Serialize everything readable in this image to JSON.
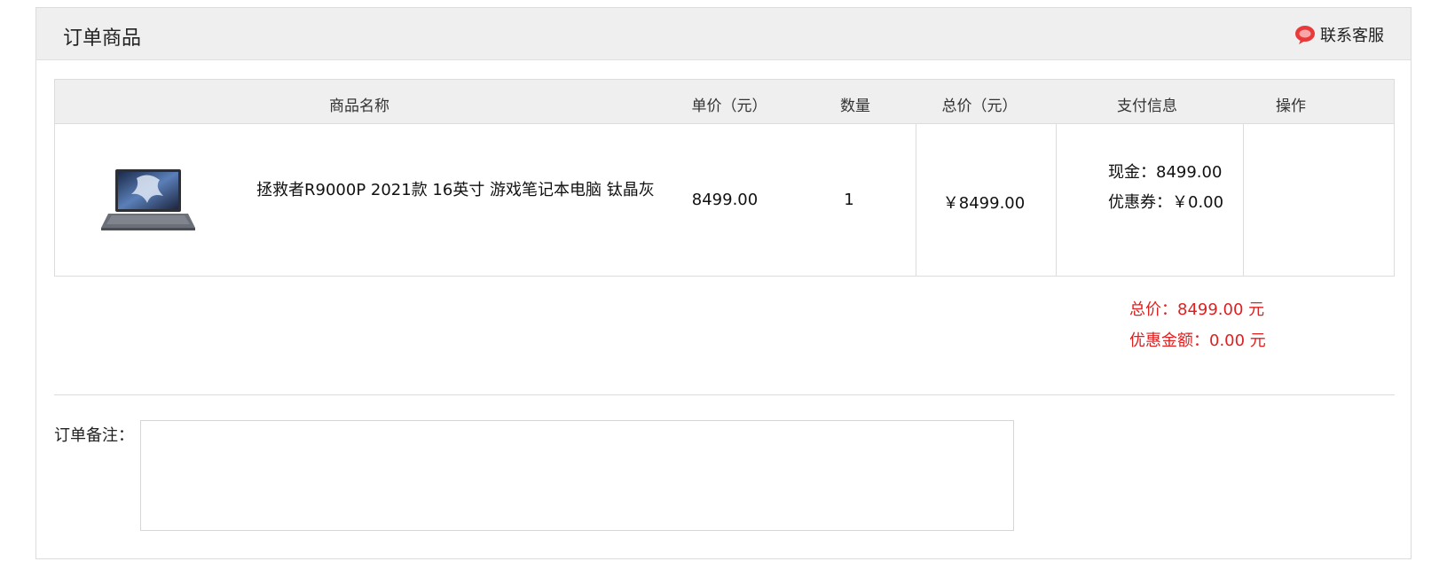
{
  "header": {
    "title": "订单商品",
    "service_label": "联系客服"
  },
  "table": {
    "columns": [
      "商品名称",
      "单价（元）",
      "数量",
      "总价（元）",
      "支付信息",
      "操作"
    ],
    "row": {
      "product_name": "拯救者R9000P 2021款 16英寸 游戏笔记本电脑 钛晶灰",
      "unit_price": "8499.00",
      "quantity": "1",
      "total": "￥8499.00",
      "cash": "现金：8499.00",
      "coupon": "优惠券：￥0.00"
    }
  },
  "summary": {
    "total": "总价：8499.00 元",
    "discount": "优惠金额：0.00 元"
  },
  "note": {
    "label": "订单备注：",
    "value": ""
  },
  "colors": {
    "accent_red": "#e01f1f",
    "header_bg": "#efefef",
    "border": "#dcdcdc"
  },
  "icons": {
    "service": "chat-bubble-icon",
    "product": "laptop-thumbnail"
  }
}
